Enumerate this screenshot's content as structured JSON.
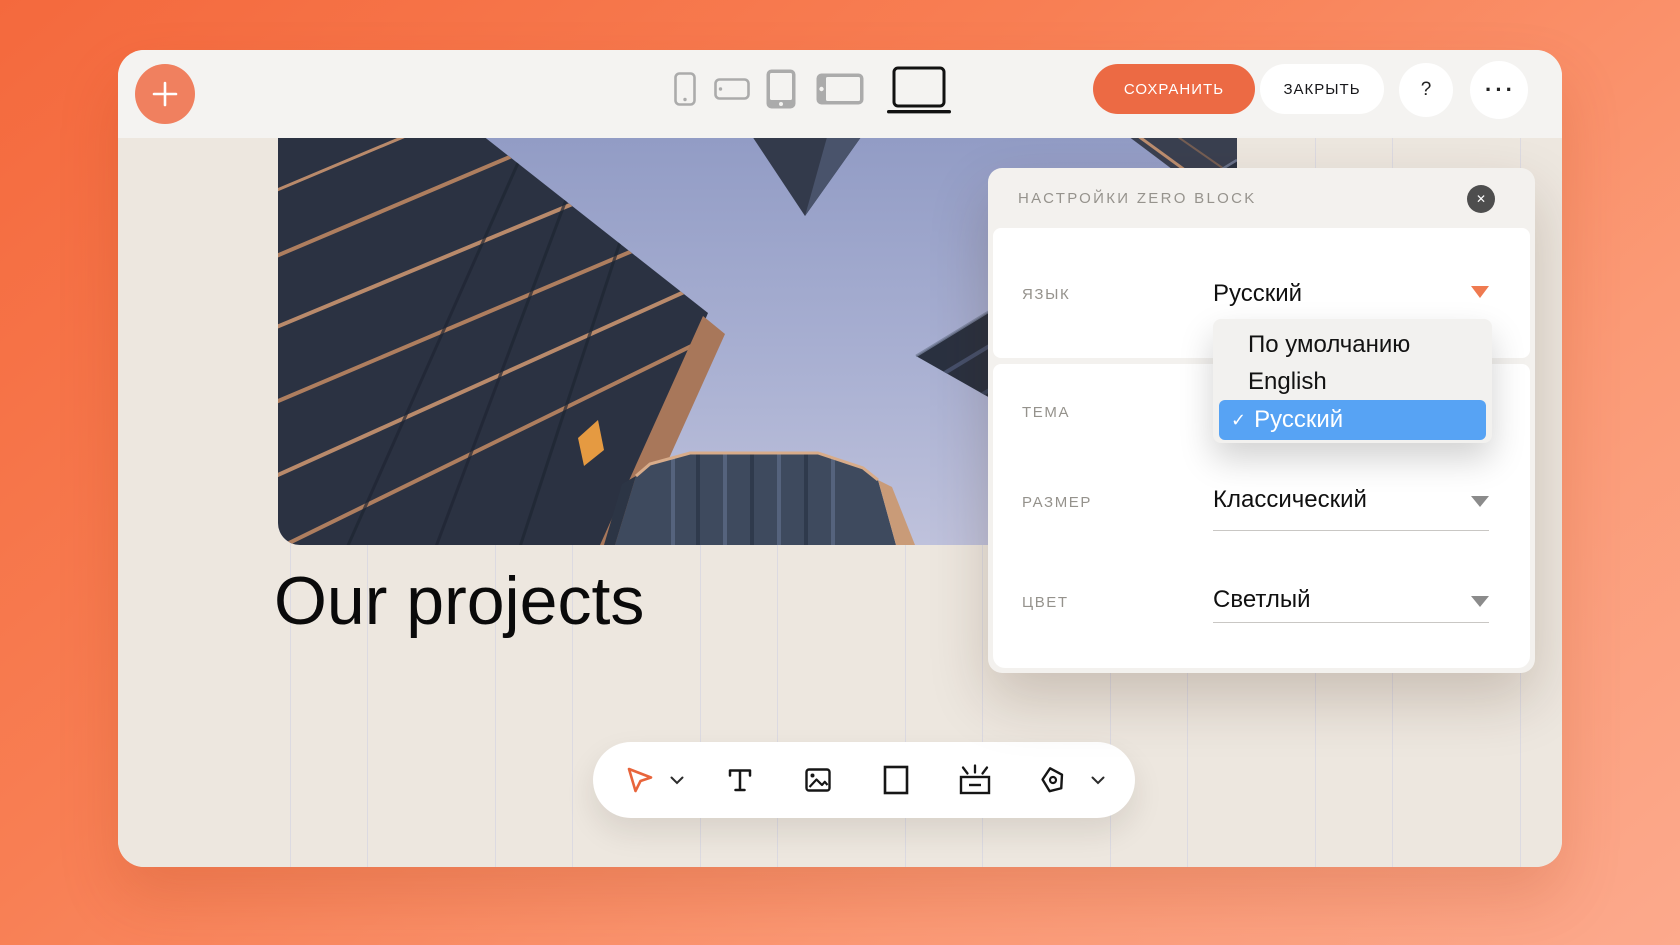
{
  "colors": {
    "accent": "#EC6A44",
    "selection_blue": "#57A3F4",
    "canvas_bg": "#EDE7DF",
    "toolbar_bg": "#F4F3F1",
    "background_gradient": [
      "#F4693D",
      "#FCA98C"
    ]
  },
  "topbar": {
    "add_label": "+",
    "devices": [
      "phone-portrait",
      "phone-landscape",
      "tablet-portrait",
      "tablet-landscape",
      "desktop"
    ],
    "active_device": "desktop",
    "save_label": "СОХРАНИТЬ",
    "close_label": "ЗАКРЫТЬ",
    "help_label": "?",
    "more_label": "···"
  },
  "canvas": {
    "heading": "Our projects"
  },
  "zero_toolbar": {
    "tools": [
      "select",
      "text",
      "image",
      "shape",
      "button",
      "vector"
    ]
  },
  "panel": {
    "title": "НАСТРОЙКИ ZERO BLOCK",
    "close_label": "✕",
    "language": {
      "label": "ЯЗЫК",
      "value": "Русский"
    },
    "theme": {
      "label": "ТЕМА"
    },
    "size": {
      "label": "РАЗМЕР",
      "value": "Классический"
    },
    "color": {
      "label": "ЦВЕТ",
      "value": "Светлый"
    },
    "language_menu": {
      "options": [
        {
          "label": "По умолчанию",
          "selected": false
        },
        {
          "label": "English",
          "selected": false
        },
        {
          "label": "Русский",
          "selected": true,
          "check": "✓"
        }
      ]
    }
  }
}
